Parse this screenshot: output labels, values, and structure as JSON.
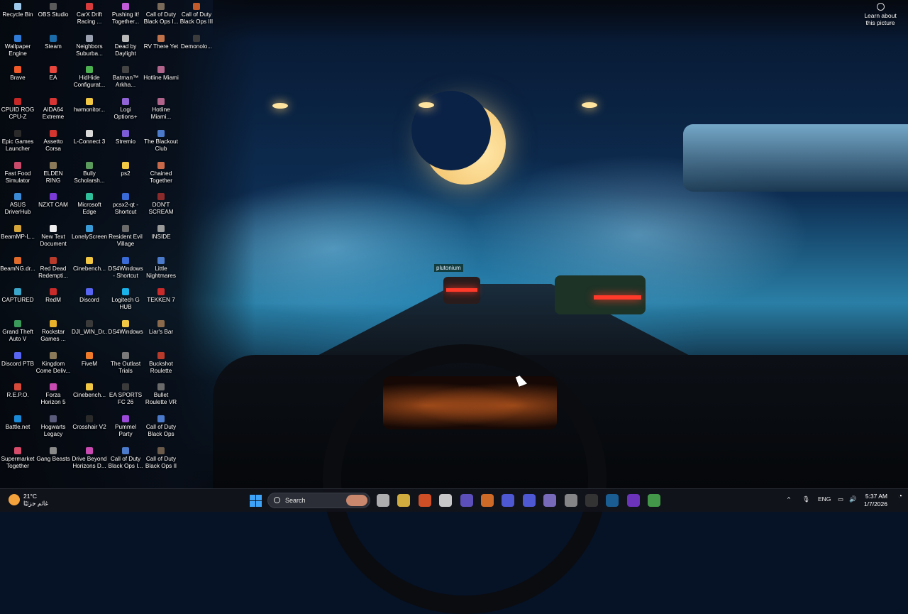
{
  "desktop_icons": [
    {
      "label": "Recycle Bin",
      "icon": "recycle-bin-icon",
      "color": "#9fc9ea"
    },
    {
      "label": "OBS Studio",
      "icon": "obs-icon",
      "color": "#5a5a5a"
    },
    {
      "label": "CarX Drift Racing ...",
      "icon": "carx-icon",
      "color": "#d73b3b"
    },
    {
      "label": "Pushing it! Together...",
      "icon": "pushing-it-icon",
      "color": "#c15ad6"
    },
    {
      "label": "Call of Duty Black Ops I...",
      "icon": "cod-icon",
      "color": "#7a6a5a"
    },
    {
      "label": "Call of Duty Black Ops III",
      "icon": "cod-icon",
      "color": "#c25a2a"
    },
    {
      "label": "Wallpaper Engine",
      "icon": "wallpaper-engine-icon",
      "color": "#2f7bd6"
    },
    {
      "label": "Steam",
      "icon": "steam-icon",
      "color": "#1b6ba8"
    },
    {
      "label": "Neighbors Suburba...",
      "icon": "neighbors-icon",
      "color": "#9aa0b0"
    },
    {
      "label": "Dead by Daylight",
      "icon": "dbd-icon",
      "color": "#b8b8b8"
    },
    {
      "label": "RV There Yet",
      "icon": "rv-icon",
      "color": "#c0724a"
    },
    {
      "label": "Demonolo...",
      "icon": "demonologist-icon",
      "color": "#3b3b3b"
    },
    {
      "label": "Brave",
      "icon": "brave-icon",
      "color": "#f05a28"
    },
    {
      "label": "EA",
      "icon": "ea-icon",
      "color": "#e8453c"
    },
    {
      "label": "HidHide Configurat...",
      "icon": "hidhide-icon",
      "color": "#4caf50"
    },
    {
      "label": "Batman™ Arkha...",
      "icon": "batman-icon",
      "color": "#444444"
    },
    {
      "label": "Hotline Miami",
      "icon": "hotline-miami-icon",
      "color": "#b0648c"
    },
    {
      "label": "CPUID ROG CPU-Z",
      "icon": "cpuz-icon",
      "color": "#c52626"
    },
    {
      "label": "AIDA64 Extreme",
      "icon": "aida64-icon",
      "color": "#d83434"
    },
    {
      "label": "hwmonitor...",
      "icon": "folder-icon",
      "color": "#f2c744"
    },
    {
      "label": "Logi Options+",
      "icon": "logi-icon",
      "color": "#8f63d6"
    },
    {
      "label": "Hotline Miami...",
      "icon": "hotline-miami-icon",
      "color": "#b0648c"
    },
    {
      "label": "Epic Games Launcher",
      "icon": "epic-icon",
      "color": "#2a2a2a"
    },
    {
      "label": "Assetto Corsa",
      "icon": "assetto-icon",
      "color": "#d4352f"
    },
    {
      "label": "L-Connect 3",
      "icon": "lconnect-icon",
      "color": "#d9d9d9"
    },
    {
      "label": "Stremio",
      "icon": "stremio-icon",
      "color": "#7b5bd6"
    },
    {
      "label": "The Blackout Club",
      "icon": "blackout-icon",
      "color": "#4a7ac9"
    },
    {
      "label": "Fast Food Simulator",
      "icon": "fastfood-icon",
      "color": "#c94a6a"
    },
    {
      "label": "ELDEN RING",
      "icon": "elden-ring-icon",
      "color": "#8a7a5a"
    },
    {
      "label": "Bully Scholarsh...",
      "icon": "bully-icon",
      "color": "#5a9a5a"
    },
    {
      "label": "ps2",
      "icon": "folder-icon",
      "color": "#f2c744"
    },
    {
      "label": "Chained Together",
      "icon": "chained-icon",
      "color": "#c86a4a"
    },
    {
      "label": "ASUS DriverHub",
      "icon": "asus-icon",
      "color": "#3a8ad6"
    },
    {
      "label": "NZXT CAM",
      "icon": "nzxt-icon",
      "color": "#7a3ad6"
    },
    {
      "label": "Microsoft Edge",
      "icon": "edge-icon",
      "color": "#2fbf9a"
    },
    {
      "label": "pcsx2-qt - Shortcut",
      "icon": "pcsx2-icon",
      "color": "#3a6ad6"
    },
    {
      "label": "DON'T SCREAM",
      "icon": "dont-scream-icon",
      "color": "#8a2a2a"
    },
    {
      "label": "BeamMP-L...",
      "icon": "beammp-icon",
      "color": "#d6a53a"
    },
    {
      "label": "New Text Document",
      "icon": "text-document-icon",
      "color": "#eeeeee"
    },
    {
      "label": "LonelyScreen",
      "icon": "lonelyscreen-icon",
      "color": "#3a9ad6"
    },
    {
      "label": "Resident Evil Village",
      "icon": "re-village-icon",
      "color": "#6a6a6a"
    },
    {
      "label": "INSIDE",
      "icon": "inside-icon",
      "color": "#9a9a9a"
    },
    {
      "label": "BeamNG.dr...",
      "icon": "beamng-icon",
      "color": "#e06a2a"
    },
    {
      "label": "Red Dead Redempti...",
      "icon": "rdr-icon",
      "color": "#b83a2a"
    },
    {
      "label": "Cinebench...",
      "icon": "folder-icon",
      "color": "#f2c744"
    },
    {
      "label": "DS4Windows - Shortcut",
      "icon": "ds4windows-icon",
      "color": "#3a6ad6"
    },
    {
      "label": "Little Nightmares",
      "icon": "little-nightmares-icon",
      "color": "#4a7ac9"
    },
    {
      "label": "CAPTURED",
      "icon": "captured-icon",
      "color": "#3aa6c9"
    },
    {
      "label": "RedM",
      "icon": "redm-icon",
      "color": "#c92a2a"
    },
    {
      "label": "Discord",
      "icon": "discord-icon",
      "color": "#5865f2"
    },
    {
      "label": "Logitech G HUB",
      "icon": "ghub-icon",
      "color": "#1ab0e8"
    },
    {
      "label": "TEKKEN 7",
      "icon": "tekken-icon",
      "color": "#c92a2a"
    },
    {
      "label": "Grand Theft Auto V",
      "icon": "gta-icon",
      "color": "#3a9a5a"
    },
    {
      "label": "Rockstar Games ...",
      "icon": "rockstar-icon",
      "color": "#e8b32a"
    },
    {
      "label": "DJI_WIN_Dr...",
      "icon": "dji-icon",
      "color": "#3a3a3a"
    },
    {
      "label": "DS4Windows",
      "icon": "folder-icon",
      "color": "#f2c744"
    },
    {
      "label": "Liar's Bar",
      "icon": "liars-bar-icon",
      "color": "#8a6a4a"
    },
    {
      "label": "Discord PTB",
      "icon": "discord-icon",
      "color": "#5865f2"
    },
    {
      "label": "Kingdom Come Deliv...",
      "icon": "kingdom-come-icon",
      "color": "#8a7a5a"
    },
    {
      "label": "FiveM",
      "icon": "fivem-icon",
      "color": "#f07a2a"
    },
    {
      "label": "The Outlast Trials",
      "icon": "outlast-icon",
      "color": "#7a7a7a"
    },
    {
      "label": "Buckshot Roulette",
      "icon": "buckshot-icon",
      "color": "#b83a2a"
    },
    {
      "label": "R.E.P.O.",
      "icon": "repo-icon",
      "color": "#d64a3a"
    },
    {
      "label": "Forza Horizon 5",
      "icon": "forza-icon",
      "color": "#c94ab0"
    },
    {
      "label": "Cinebench...",
      "icon": "folder-icon",
      "color": "#f2c744"
    },
    {
      "label": "EA SPORTS FC 26",
      "icon": "eafc-icon",
      "color": "#3a3a3a"
    },
    {
      "label": "Bullet Roulette VR",
      "icon": "bullet-roulette-icon",
      "color": "#6a6a6a"
    },
    {
      "label": "Battle.net",
      "icon": "battlenet-icon",
      "color": "#1a8ad6"
    },
    {
      "label": "Hogwarts Legacy",
      "icon": "hogwarts-icon",
      "color": "#5a5a7a"
    },
    {
      "label": "Crosshair V2",
      "icon": "crosshair-icon",
      "color": "#2a2a2a"
    },
    {
      "label": "Pummel Party",
      "icon": "pummel-icon",
      "color": "#9a4ad6"
    },
    {
      "label": "Call of Duty Black Ops",
      "icon": "cod-icon",
      "color": "#4a7ac9"
    },
    {
      "label": "Supermarket Together",
      "icon": "supermarket-icon",
      "color": "#d64a6a"
    },
    {
      "label": "Gang Beasts",
      "icon": "gang-beasts-icon",
      "color": "#8a8a8a"
    },
    {
      "label": "Drive Beyond Horizons D...",
      "icon": "drive-beyond-icon",
      "color": "#c94ab0"
    },
    {
      "label": "Call of Duty Black Ops I...",
      "icon": "cod-icon",
      "color": "#4a7ac9"
    },
    {
      "label": "Call of Duty Black Ops II",
      "icon": "cod-icon",
      "color": "#6a5a4a"
    }
  ],
  "learn_about": {
    "label": "Learn about this picture"
  },
  "wallpaper": {
    "sign_text": "plutonium"
  },
  "taskbar": {
    "weather_temp": "21°C",
    "weather_desc": "غائم جزئيًا",
    "search_placeholder": "Search",
    "language": "ENG",
    "time": "5:37 AM",
    "date": "1/7/2026",
    "pinned": [
      {
        "name": "task-view-icon",
        "color": "#c9c9c9"
      },
      {
        "name": "file-explorer-icon",
        "color": "#f2c744"
      },
      {
        "name": "brave-icon",
        "color": "#f05a28"
      },
      {
        "name": "chrome-icon",
        "color": "#e8e8e8"
      },
      {
        "name": "teams-icon",
        "color": "#6a5ad6"
      },
      {
        "name": "app-icon",
        "color": "#f07a2a"
      },
      {
        "name": "discord-icon",
        "color": "#5865f2"
      },
      {
        "name": "discord-ptb-icon",
        "color": "#5865f2"
      },
      {
        "name": "controller-icon",
        "color": "#8a7ad6"
      },
      {
        "name": "settings-icon",
        "color": "#9a9a9a"
      },
      {
        "name": "terminal-icon",
        "color": "#3a3a3a"
      },
      {
        "name": "steam-icon",
        "color": "#1b6ba8"
      },
      {
        "name": "nzxt-icon",
        "color": "#7a3ad6"
      },
      {
        "name": "xbox-icon",
        "color": "#4caf50"
      }
    ]
  }
}
